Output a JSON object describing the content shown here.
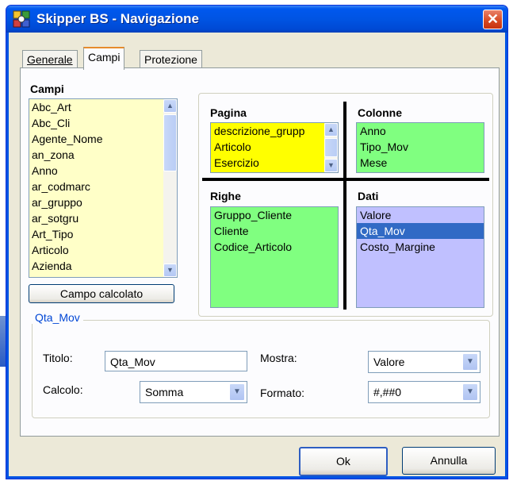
{
  "window": {
    "title": "Skipper BS - Navigazione",
    "close_glyph": "✕"
  },
  "tabs": [
    {
      "label": "Generale",
      "active": false
    },
    {
      "label": "Campi",
      "active": true
    },
    {
      "label": "Protezione",
      "active": false
    }
  ],
  "campi": {
    "heading": "Campi",
    "items": [
      "Abc_Art",
      "Abc_Cli",
      "Agente_Nome",
      "an_zona",
      "Anno",
      "ar_codmarc",
      "ar_gruppo",
      "ar_sotgru",
      "Art_Tipo",
      "Articolo",
      "Azienda"
    ],
    "calc_button": "Campo calcolato"
  },
  "zones": {
    "pagina": {
      "heading": "Pagina",
      "items": [
        "descrizione_grupp",
        "Articolo",
        "Esercizio"
      ],
      "color": "#ffff00"
    },
    "colonne": {
      "heading": "Colonne",
      "items": [
        "Anno",
        "Tipo_Mov",
        "Mese"
      ],
      "color": "#80ff80"
    },
    "righe": {
      "heading": "Righe",
      "items": [
        "Gruppo_Cliente",
        "Cliente",
        "Codice_Articolo"
      ],
      "color": "#80ff80"
    },
    "dati": {
      "heading": "Dati",
      "items": [
        "Valore",
        "Qta_Mov",
        "Costo_Margine"
      ],
      "selected": "Qta_Mov",
      "color": "#c0c0ff"
    }
  },
  "field_group": {
    "legend": "Qta_Mov",
    "titolo_label": "Titolo:",
    "titolo_value": "Qta_Mov",
    "calcolo_label": "Calcolo:",
    "calcolo_value": "Somma",
    "mostra_label": "Mostra:",
    "mostra_value": "Valore",
    "formato_label": "Formato:",
    "formato_value": "#,##0"
  },
  "buttons": {
    "ok": "Ok",
    "annulla": "Annulla"
  },
  "icons": {
    "scroll_up": "▲",
    "scroll_down": "▼",
    "dropdown": "▼"
  }
}
